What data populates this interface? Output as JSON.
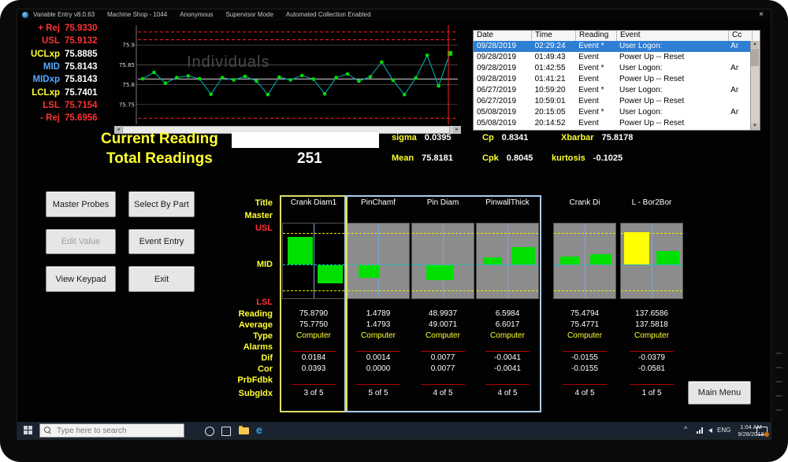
{
  "window": {
    "title_parts": [
      "Variable Entry v8.0.63",
      "Machine Shop - 1044",
      "Anonymous",
      "Supervisor Mode",
      "Automated Collection Enabled"
    ],
    "close_label": "×"
  },
  "limits_panel": {
    "rows": [
      {
        "label": "+ Rej",
        "value": "75.9330",
        "label_color": "#ff3232",
        "value_color": "#ff3232"
      },
      {
        "label": "USL",
        "value": "75.9132",
        "label_color": "#ff3232",
        "value_color": "#ff3232"
      },
      {
        "label": "UCLxp",
        "value": "75.8885",
        "label_color": "#ffff32",
        "value_color": "#ffffff"
      },
      {
        "label": "MID",
        "value": "75.8143",
        "label_color": "#55aaff",
        "value_color": "#ffffff"
      },
      {
        "label": "MIDxp",
        "value": "75.8143",
        "label_color": "#55aaff",
        "value_color": "#ffffff"
      },
      {
        "label": "LCLxp",
        "value": "75.7401",
        "label_color": "#ffff32",
        "value_color": "#ffffff"
      },
      {
        "label": "LSL",
        "value": "75.7154",
        "label_color": "#ff3232",
        "value_color": "#ff3232"
      },
      {
        "label": "- Rej",
        "value": "75.6956",
        "label_color": "#ff3232",
        "value_color": "#ff3232"
      }
    ]
  },
  "chart_data": {
    "type": "line",
    "watermark": "Individuals",
    "values": [
      75.815,
      75.831,
      75.804,
      75.818,
      75.822,
      75.815,
      75.776,
      75.818,
      75.812,
      75.821,
      75.809,
      75.775,
      75.819,
      75.812,
      75.823,
      75.814,
      75.777,
      75.818,
      75.827,
      75.809,
      75.82,
      75.857,
      75.811,
      75.775,
      75.817,
      75.874,
      75.797,
      75.879
    ],
    "ylim": [
      75.7,
      75.95
    ],
    "yticks": [
      {
        "value": 75.9,
        "label": "75.9"
      },
      {
        "value": 75.85,
        "label": "75.85"
      },
      {
        "value": 75.8,
        "label": "75.8"
      },
      {
        "value": 75.75,
        "label": "75.75"
      }
    ],
    "center_line": 75.8143,
    "usl": 75.9132,
    "lsl": 75.7154,
    "plus_rej": 75.933,
    "minus_rej": 75.6956,
    "point_color": "#00dd00",
    "line_color": "#00b8b8",
    "limit_color": "#ff2020"
  },
  "event_log": {
    "headers": [
      "Date",
      "Time",
      "Reading",
      "Event",
      "Cc"
    ],
    "rows": [
      {
        "date": "09/28/2019",
        "time": "02:29:24",
        "reading": "Event *",
        "event": "User Logon:",
        "cc": "Ar",
        "selected": true
      },
      {
        "date": "09/28/2019",
        "time": "01:49:43",
        "reading": "Event",
        "event": "Power Up -- Reset",
        "cc": "",
        "selected": false
      },
      {
        "date": "09/28/2019",
        "time": "01:42:55",
        "reading": "Event *",
        "event": "User Logon:",
        "cc": "Ar",
        "selected": false
      },
      {
        "date": "09/28/2019",
        "time": "01:41:21",
        "reading": "Event",
        "event": "Power Up -- Reset",
        "cc": "",
        "selected": false
      },
      {
        "date": "06/27/2019",
        "time": "10:59:20",
        "reading": "Event *",
        "event": "User Logon:",
        "cc": "Ar",
        "selected": false
      },
      {
        "date": "06/27/2019",
        "time": "10:59:01",
        "reading": "Event",
        "event": "Power Up -- Reset",
        "cc": "",
        "selected": false
      },
      {
        "date": "05/08/2019",
        "time": "20:15:05",
        "reading": "Event *",
        "event": "User Logon:",
        "cc": "Ar",
        "selected": false
      },
      {
        "date": "05/08/2019",
        "time": "20:14:52",
        "reading": "Event",
        "event": "Power Up -- Reset",
        "cc": "",
        "selected": false
      }
    ]
  },
  "readings": {
    "current_label": "Current Reading",
    "current_value": "",
    "total_label": "Total Readings",
    "total_value": "251"
  },
  "stats": [
    {
      "label": "sigma",
      "value": "0.0395"
    },
    {
      "label": "Cp",
      "value": "0.8341"
    },
    {
      "label": "Xbarbar",
      "value": "75.8178"
    },
    {
      "label": "Mean",
      "value": "75.8181"
    },
    {
      "label": "Cpk",
      "value": "0.8045"
    },
    {
      "label": "kurtosis",
      "value": "-0.1025"
    }
  ],
  "buttons": {
    "master_probes": "Master Probes",
    "select_by_part": "Select By Part",
    "edit_value": "Edit Value",
    "event_entry": "Event Entry",
    "view_keypad": "View Keypad",
    "exit": "Exit",
    "main_menu": "Main Menu"
  },
  "gauges": {
    "row_labels": [
      {
        "label": "Title",
        "color": "#ffff32"
      },
      {
        "label": "Master",
        "color": "#ffff32"
      },
      {
        "label": "USL",
        "color": "#ff3232"
      },
      {
        "label": "MID",
        "color": "#ffff32"
      },
      {
        "label": "LSL",
        "color": "#ff3232"
      },
      {
        "label": "Reading",
        "color": "#ffff32"
      },
      {
        "label": "Average",
        "color": "#ffff32"
      },
      {
        "label": "Type",
        "color": "#ffff32"
      },
      {
        "label": "Alarms",
        "color": "#ffff32"
      },
      {
        "label": "Dif",
        "color": "#ffff32"
      },
      {
        "label": "Cor",
        "color": "#ffff32"
      },
      {
        "label": "PrbFdbk",
        "color": "#ffff32"
      },
      {
        "label": "SubgIdx",
        "color": "#ffff32"
      }
    ],
    "channels": [
      {
        "title": "Crank Diam1",
        "reading": "75.8790",
        "average": "75.7750",
        "type": "Computer",
        "dif": "0.0184",
        "cor": "0.0393",
        "subgidx": "3 of 5",
        "chart_bg": "#000000",
        "bars": [
          {
            "x": 0.08,
            "w": 0.4,
            "dir": "up",
            "h": 0.72,
            "color": "#00e000"
          },
          {
            "x": 0.55,
            "w": 0.4,
            "dir": "down",
            "h": 0.52,
            "color": "#00e000"
          }
        ]
      },
      {
        "title": "PinChamf",
        "reading": "1.4789",
        "average": "1.4793",
        "type": "Computer",
        "dif": "0.0014",
        "cor": "0.0000",
        "subgidx": "5 of 5",
        "chart_bg": "#8c8c8c",
        "bars": [
          {
            "x": 0.18,
            "w": 0.32,
            "dir": "down",
            "h": 0.36,
            "color": "#00e000"
          }
        ]
      },
      {
        "title": "Pin Diam",
        "reading": "48.9937",
        "average": "49.0071",
        "type": "Computer",
        "dif": "0.0077",
        "cor": "0.0077",
        "subgidx": "4 of 5",
        "chart_bg": "#8c8c8c",
        "bars": [
          {
            "x": 0.22,
            "w": 0.44,
            "dir": "down",
            "h": 0.42,
            "color": "#00e000"
          }
        ]
      },
      {
        "title": "PinwallThick",
        "reading": "6.5984",
        "average": "6.6017",
        "type": "Computer",
        "dif": "-0.0041",
        "cor": "-0.0041",
        "subgidx": "4 of 5",
        "chart_bg": "#8c8c8c",
        "bars": [
          {
            "x": 0.1,
            "w": 0.3,
            "dir": "up",
            "h": 0.18,
            "color": "#00e000"
          },
          {
            "x": 0.55,
            "w": 0.38,
            "dir": "up",
            "h": 0.46,
            "color": "#00e000"
          }
        ]
      },
      {
        "title": "Crank Di",
        "reading": "75.4794",
        "average": "75.4771",
        "type": "Computer",
        "dif": "-0.0155",
        "cor": "-0.0155",
        "subgidx": "4 of 5",
        "chart_bg": "#8c8c8c",
        "bars": [
          {
            "x": 0.1,
            "w": 0.3,
            "dir": "up",
            "h": 0.2,
            "color": "#00e000"
          },
          {
            "x": 0.58,
            "w": 0.34,
            "dir": "up",
            "h": 0.28,
            "color": "#00e000"
          }
        ]
      },
      {
        "title": "L - Bor2Bor",
        "reading": "137.6586",
        "average": "137.5818",
        "type": "Computer",
        "dif": "-0.0379",
        "cor": "-0.0581",
        "subgidx": "1 of 5",
        "chart_bg": "#8c8c8c",
        "bars": [
          {
            "x": 0.05,
            "w": 0.4,
            "dir": "up",
            "h": 0.85,
            "color": "#ffff00"
          },
          {
            "x": 0.56,
            "w": 0.36,
            "dir": "up",
            "h": 0.35,
            "color": "#00e000"
          }
        ]
      }
    ]
  },
  "taskbar": {
    "search_placeholder": "Type here to search",
    "language": "ENG",
    "time": "1:04 AM",
    "date": "9/28/2019"
  }
}
